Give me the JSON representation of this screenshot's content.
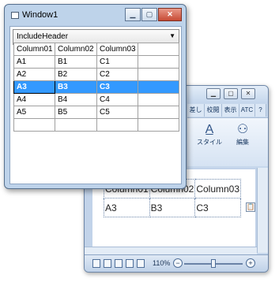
{
  "back_window": {
    "ribbon_tabs": [
      "差し",
      "校閲",
      "表示",
      "ATC",
      "?"
    ],
    "ribbon_buttons": [
      {
        "label": "スタイル",
        "icon": "style-a-icon"
      },
      {
        "label": "編集",
        "icon": "binoculars-icon"
      }
    ],
    "table": [
      [
        "Column01",
        "Column02",
        "Column03"
      ],
      [
        "A3",
        "B3",
        "C3"
      ]
    ],
    "zoom": "110%"
  },
  "window": {
    "title": "Window1",
    "combo": {
      "selected": "IncludeHeader"
    },
    "grid": {
      "columns": [
        "Column01",
        "Column02",
        "Column03",
        ""
      ],
      "rows": [
        [
          "A1",
          "B1",
          "C1",
          ""
        ],
        [
          "A2",
          "B2",
          "C2",
          ""
        ],
        [
          "A3",
          "B3",
          "C3",
          ""
        ],
        [
          "A4",
          "B4",
          "C4",
          ""
        ],
        [
          "A5",
          "B5",
          "C5",
          ""
        ],
        [
          "",
          "",
          "",
          ""
        ]
      ],
      "selected_row": 2
    }
  },
  "colors": {
    "selection": "#3399ff",
    "close_button": "#c74a34"
  }
}
